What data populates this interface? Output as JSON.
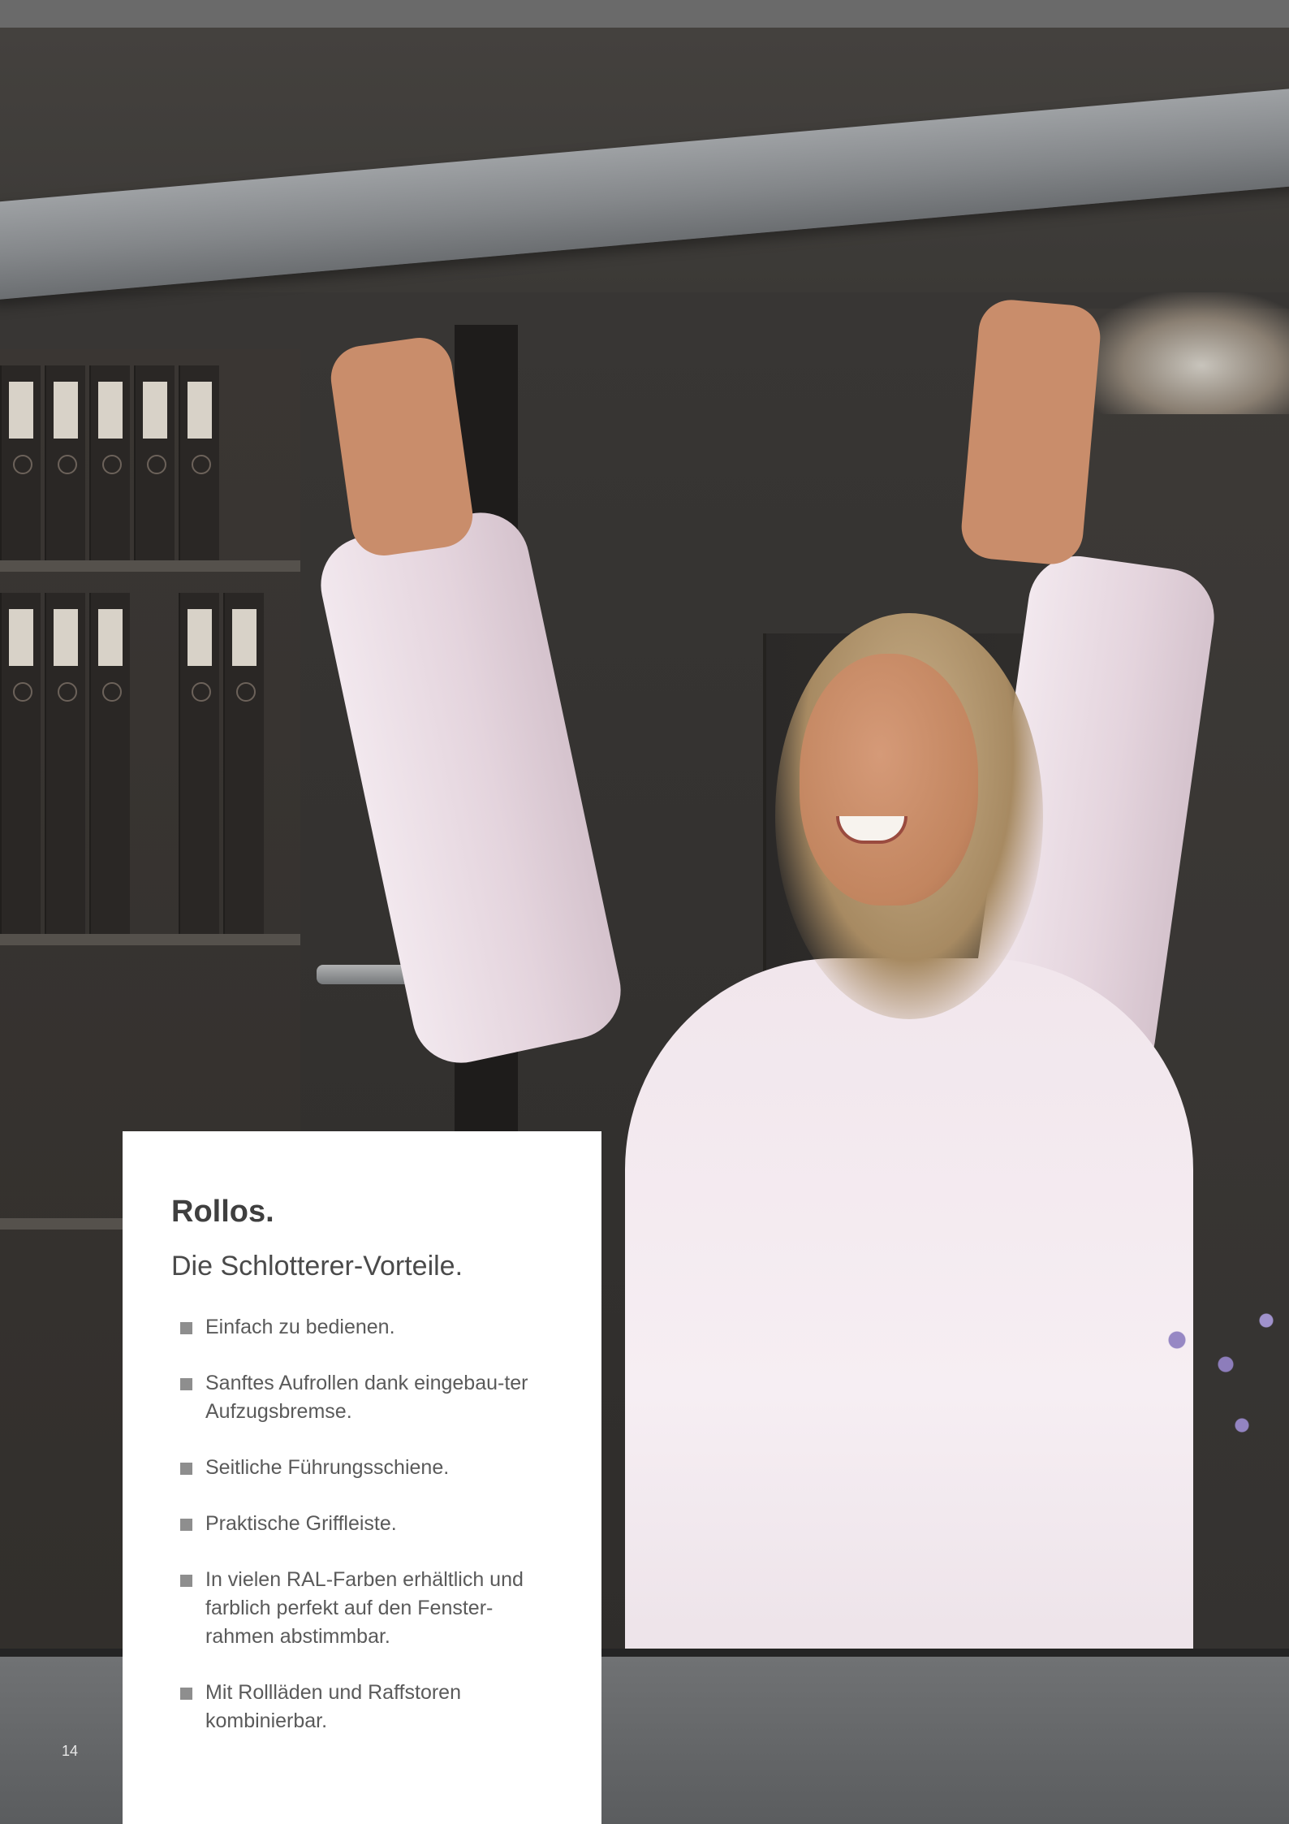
{
  "panel": {
    "title": "Rollos.",
    "subtitle": "Die Schlotterer-Vorteile.",
    "benefits": [
      "Einfach zu bedienen.",
      "Sanftes Aufrollen dank eingebau-ter Aufzugsbremse.",
      "Seitliche Führungsschiene.",
      "Praktische Griffleiste.",
      "In vielen RAL-Farben erhältlich und farblich perfekt auf den Fenster-rahmen abstimmbar.",
      "Mit Rollläden und Raffstoren kombinierbar."
    ]
  },
  "page_number": "14",
  "colors": {
    "panel_background": "#ffffff",
    "title_text": "#3f3f3f",
    "body_text": "#5a5a5a",
    "bullet": "#8e8e8e",
    "page_number": "#e8e8e8"
  }
}
